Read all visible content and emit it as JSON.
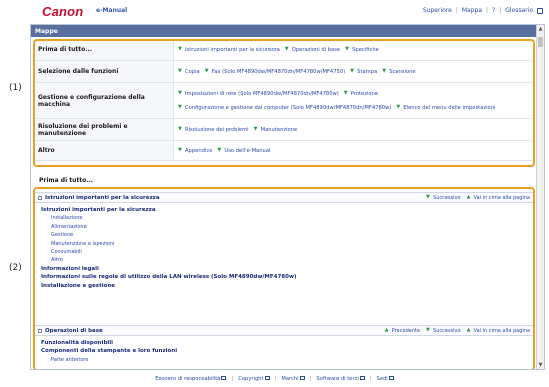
{
  "header": {
    "logo": "Canon",
    "product": "e-Manual",
    "links": {
      "top": "Superiore",
      "map": "Mappa",
      "help": "?",
      "glossary": "Glossario"
    }
  },
  "mappe": {
    "title": "Mappe",
    "rows": [
      {
        "category": "Prima di tutto...",
        "links": [
          "Istruzioni importanti per la sicurezza",
          "Operazioni di base",
          "Specifiche"
        ]
      },
      {
        "category": "Selezione dalle funzioni",
        "links": [
          "Copia",
          "Fax (Solo MF4890dw/MF4870dn/MF4780w/MF4750)",
          "Stampa",
          "Scansione"
        ]
      },
      {
        "category": "Gestione e configurazione della macchina",
        "links": [
          "Impostazioni di rete (Solo MF4890dw/MF4870dn/MF4780w)",
          "Protezione",
          "Configurazione e gestione dal computer (Solo MF4890dw/MF4870dn/MF4780w)",
          "Elenco del menu delle impostazioni"
        ]
      },
      {
        "category": "Risoluzione dei problemi e manutenzione",
        "links": [
          "Risoluzione dei problemi",
          "Manutenzione"
        ]
      },
      {
        "category": "Altro",
        "links": [
          "Appendice",
          "Uso dell'e-Manual"
        ]
      }
    ]
  },
  "annotations": {
    "label1": "(1)",
    "label2": "(2)"
  },
  "section": {
    "title": "Prima di tutto...",
    "block1": {
      "head": "Istruzioni importanti per la sicurezza",
      "next": "Successivo",
      "top": "Vai in cima alla pagina",
      "items": [
        {
          "level": 1,
          "text": "Istruzioni importanti per la sicurezza"
        },
        {
          "level": 2,
          "text": "Installazione"
        },
        {
          "level": 2,
          "text": "Alimentazione"
        },
        {
          "level": 2,
          "text": "Gestione"
        },
        {
          "level": 2,
          "text": "Manutenzione e ispezioni"
        },
        {
          "level": 2,
          "text": "Consumabili"
        },
        {
          "level": 2,
          "text": "Altro"
        },
        {
          "level": 1,
          "text": "Informazioni legali"
        },
        {
          "level": 1,
          "text": "Informazioni sulle regole di utilizzo della LAN wireless (Solo MF4890dw/MF4780w)"
        },
        {
          "level": 1,
          "text": "Installazione e gestione"
        }
      ]
    },
    "block2": {
      "head": "Operazioni di base",
      "prev": "Precedente",
      "next": "Successivo",
      "top": "Vai in cima alla pagina",
      "items": [
        {
          "level": 1,
          "text": "Funzionalità disponibili"
        },
        {
          "level": 1,
          "text": "Componenti della stampante e loro funzioni"
        },
        {
          "level": 2,
          "text": "Parte anteriore"
        }
      ]
    }
  },
  "footer": {
    "links": [
      "Esonero di responsabilità",
      "Copyright",
      "Marchi",
      "Software di terzi",
      "Sedi"
    ]
  },
  "colors": {
    "highlight": "#e8a020",
    "header_bar": "#5a6f9e",
    "link": "#2a4aa8",
    "brand": "#c8102e"
  }
}
